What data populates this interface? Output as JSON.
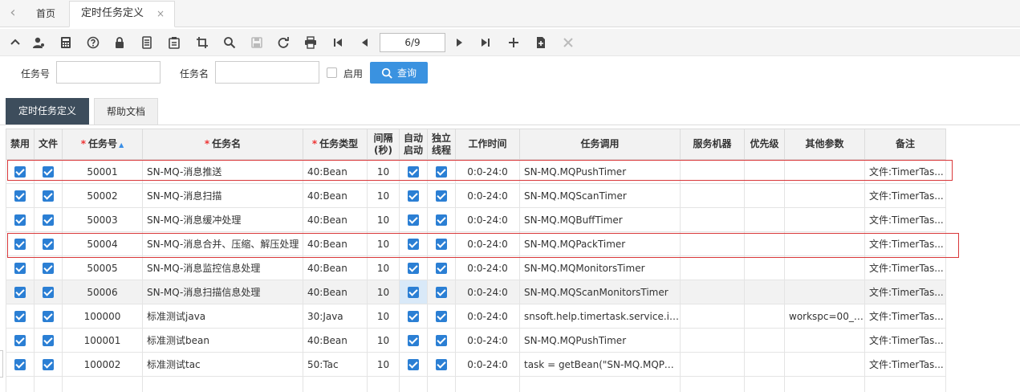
{
  "tabs": {
    "home": "首页",
    "active": "定时任务定义",
    "close": "×"
  },
  "toolbar": {
    "page_indicator": "6/9"
  },
  "search": {
    "task_no_label": "任务号",
    "task_no_value": "",
    "task_name_label": "任务名",
    "task_name_value": "",
    "enabled_label": "启用",
    "query_label": "查询"
  },
  "subtabs": {
    "definition": "定时任务定义",
    "help": "帮助文档"
  },
  "grid": {
    "headers": {
      "disabled": "禁用",
      "file": "文件",
      "task_no": "任务号",
      "task_name": "任务名",
      "task_type": "任务类型",
      "interval_1": "间隔",
      "interval_2": "(秒)",
      "auto_1": "自动",
      "auto_2": "启动",
      "thread_1": "独立",
      "thread_2": "线程",
      "work_time": "工作时间",
      "invoke": "任务调用",
      "server": "服务机器",
      "priority": "优先级",
      "params": "其他参数",
      "remark": "备注"
    },
    "rows": [
      {
        "no": "50001",
        "name": "SN-MQ-消息推送",
        "type": "40:Bean",
        "interval": "10",
        "time": "0:0-24:0",
        "invoke": "SN-MQ.MQPushTimer",
        "params": "",
        "remark": "文件:TimerTas..."
      },
      {
        "no": "50002",
        "name": "SN-MQ-消息扫描",
        "type": "40:Bean",
        "interval": "10",
        "time": "0:0-24:0",
        "invoke": "SN-MQ.MQScanTimer",
        "params": "",
        "remark": "文件:TimerTas..."
      },
      {
        "no": "50003",
        "name": "SN-MQ-消息缓冲处理",
        "type": "40:Bean",
        "interval": "10",
        "time": "0:0-24:0",
        "invoke": "SN-MQ.MQBuffTimer",
        "params": "",
        "remark": "文件:TimerTas..."
      },
      {
        "no": "50004",
        "name": "SN-MQ-消息合并、压缩、解压处理",
        "type": "40:Bean",
        "interval": "10",
        "time": "0:0-24:0",
        "invoke": "SN-MQ.MQPackTimer",
        "params": "",
        "remark": "文件:TimerTas..."
      },
      {
        "no": "50005",
        "name": "SN-MQ-消息监控信息处理",
        "type": "40:Bean",
        "interval": "10",
        "time": "0:0-24:0",
        "invoke": "SN-MQ.MQMonitorsTimer",
        "params": "",
        "remark": "文件:TimerTas..."
      },
      {
        "no": "50006",
        "name": "SN-MQ-消息扫描信息处理",
        "type": "40:Bean",
        "interval": "10",
        "time": "0:0-24:0",
        "invoke": "SN-MQ.MQScanMonitorsTimer",
        "params": "",
        "remark": "文件:TimerTas..."
      },
      {
        "no": "100000",
        "name": "标准测试java",
        "type": "30:Java",
        "interval": "10",
        "time": "0:0-24:0",
        "invoke": "snsoft.help.timertask.service.impl...",
        "params": "workspc=00_l...",
        "remark": "文件:TimerTas..."
      },
      {
        "no": "100001",
        "name": "标准测试bean",
        "type": "40:Bean",
        "interval": "10",
        "time": "0:0-24:0",
        "invoke": "SN-MQ.MQPushTimer",
        "params": "",
        "remark": "文件:TimerTas..."
      },
      {
        "no": "100002",
        "name": "标准测试tac",
        "type": "50:Tac",
        "interval": "10",
        "time": "0:0-24:0",
        "invoke": "task = getBean(\"SN-MQ.MQPus...",
        "params": "",
        "remark": "文件:TimerTas..."
      }
    ]
  }
}
